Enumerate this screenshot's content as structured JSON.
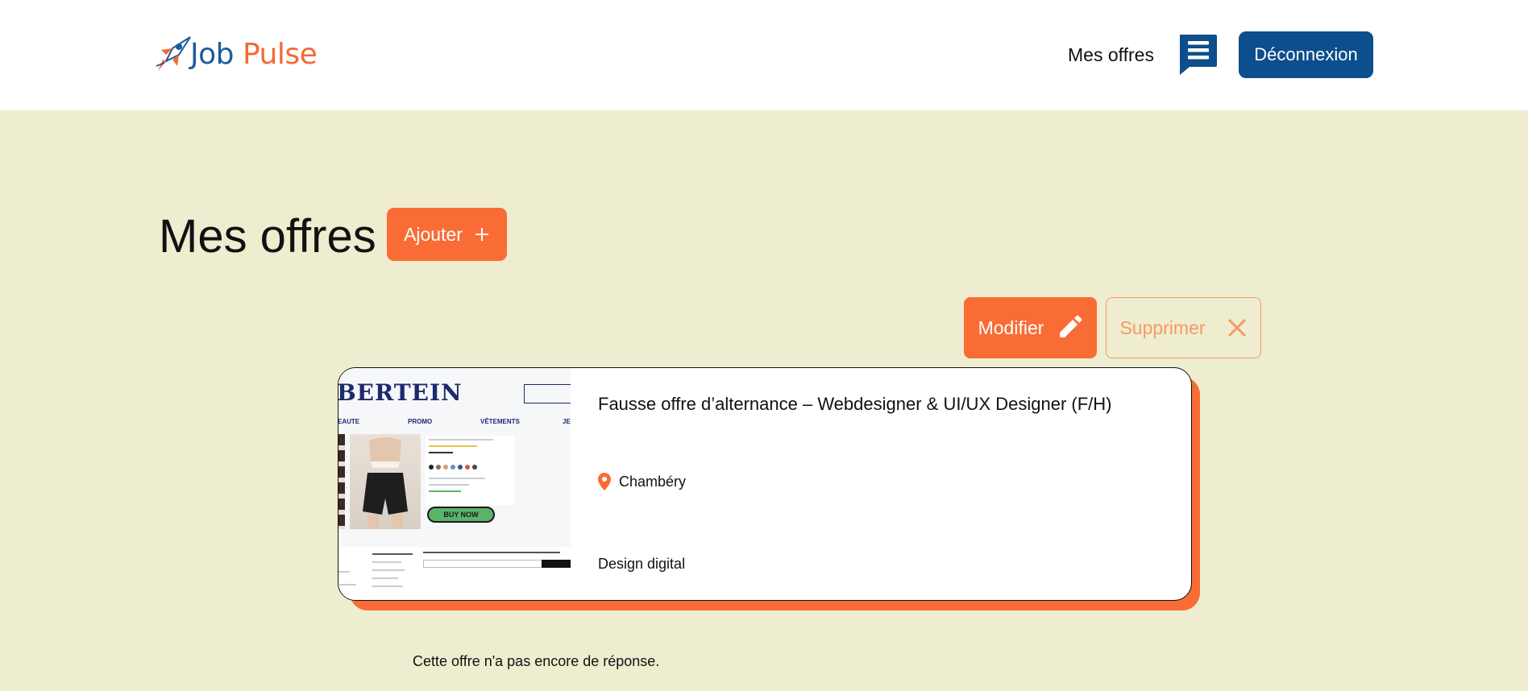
{
  "header": {
    "logo": {
      "part1": "Job",
      "part2": "Pulse"
    },
    "nav_mes_offres": "Mes offres",
    "logout_label": "Déconnexion"
  },
  "main": {
    "title": "Mes offres",
    "add_label": "Ajouter",
    "edit_label": "Modifier",
    "delete_label": "Supprimer"
  },
  "offer": {
    "title": "Fausse offre d’alternance – Webdesigner & UI/UX Designer (F/H)",
    "location": "Chambéry",
    "category": "Design digital",
    "thumbnail": {
      "brand": "BERTEIN",
      "nav": [
        "EAUTE",
        "PROMO",
        "VÊTEMENTS",
        "JE"
      ],
      "buy_now": "BUY NOW"
    }
  },
  "status_text": "Cette offre n'a pas encore de réponse.",
  "colors": {
    "accent_orange": "#f96c35",
    "brand_blue": "#0d4e8c",
    "background": "#efedcf"
  }
}
